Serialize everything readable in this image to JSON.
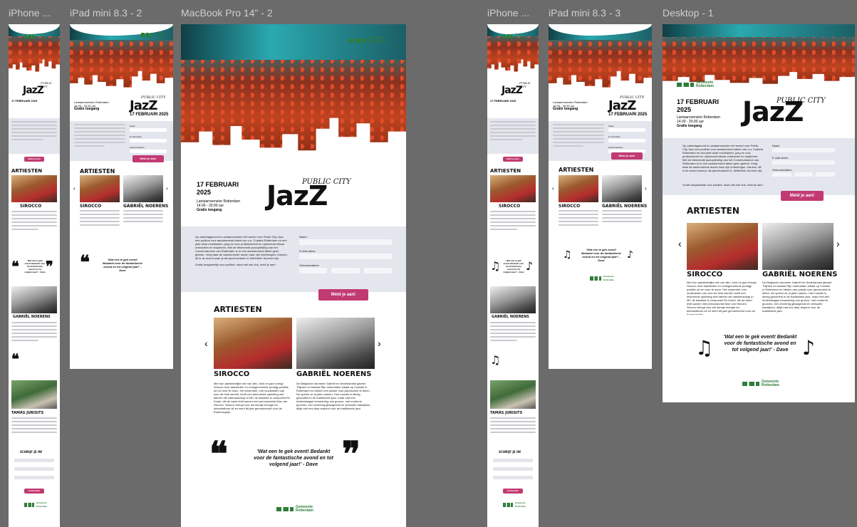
{
  "frames": [
    {
      "label": "iPhone ..."
    },
    {
      "label": "iPad mini 8.3 - 2"
    },
    {
      "label": "MacBook Pro 14\" - 2"
    },
    {
      "label": "iPhone ..."
    },
    {
      "label": "iPad mini 8.3 - 3"
    },
    {
      "label": "Desktop - 1"
    }
  ],
  "brand": {
    "logo_text": "Gemeente Rotterdam",
    "accent": "#c23a72",
    "green": "#2f7d3a"
  },
  "event": {
    "public_city": "PUBLIC CITY",
    "title": "JazZ",
    "date": "17 FEBRUARI 2025",
    "date_short": "17 FEBRUARI",
    "year": "2025",
    "venue": "Lantaarnvenster Rotterdam",
    "time": "14.00 - 20.00 uur",
    "price": "Gratis toegang"
  },
  "intro": {
    "text": "Op zaterdagavond is Lantaarnvenster het toneel voor Public City Jazz een podium voor aanstormend talent van o.a. Codarts Rotterdam en een plek waar muzikanten, jong en oud, professioneel en opkomend elkaar ontmoeten en inspireren. Met de tekenende jazzopleiding van het Conservatorium van Rotterdam is er een aanstormend talent geen gebrek. Vorig daar de aankomende dozen naar zijn entreeingen. Kansen, dit is de avond waar je als jazzmuzikant of -liefhebber bij moet zijn.",
    "closing": "Gratis toegankelijk voor publiek, maar wél wel dus, meld je aan!"
  },
  "form": {
    "name_label": "Naam",
    "email_label": "E-mail adres",
    "dob_label": "Geboortedatum",
    "submit": "Meld je aan!",
    "section_title": "SCHRIJF JE IN!",
    "submit_mobile": "Aanmelden"
  },
  "artists": {
    "title": "ARTIESTEN",
    "items": [
      {
        "name": "SIROCCO",
        "bio": "Met hun aanstekelijke mix van afro, funk en jazz brengt Sirocco door bandleden en rootsgrenzende prodigy publiek uit om mee te doen. Het ensemble, met muzikanten van over de hele wereld, heeft een tekenende opleiding met sterren die vakmanschap in MC de bassiste is componist Ro Kuriel, die de band leidt samen met percussionist Max van Heuven. Sirocco brengt voor elk dansje energie ter debuutalbum uit en werd dit jaar genomineerd voor de Erasmusprijs."
      },
      {
        "name": "GABRIËL NOERENS",
        "bio": "De Belgische drummer Gabriël en Nederlandse gitarist Thijmen en bassist Rijn ontmoetten elkaar op Codarts in Rotterdam en bleken een passie voor jazzmuziek te delen. Nu spelen ze al jaren samen. Hun muziek is stevig geworteld in de traditionele jazz, maar met een hedendaagse benadering van groove, met moderne grooves, een dromerig gitaargeluid en sensuele basslijnen, altijd met een diep respect voor de traditionele jazz."
      },
      {
        "name": "TAMÁS JURISITS"
      }
    ]
  },
  "quote": {
    "text": "'Wat een te gek event! Bedankt voor de fantastische avond en tot volgend jaar!' - Dave"
  }
}
